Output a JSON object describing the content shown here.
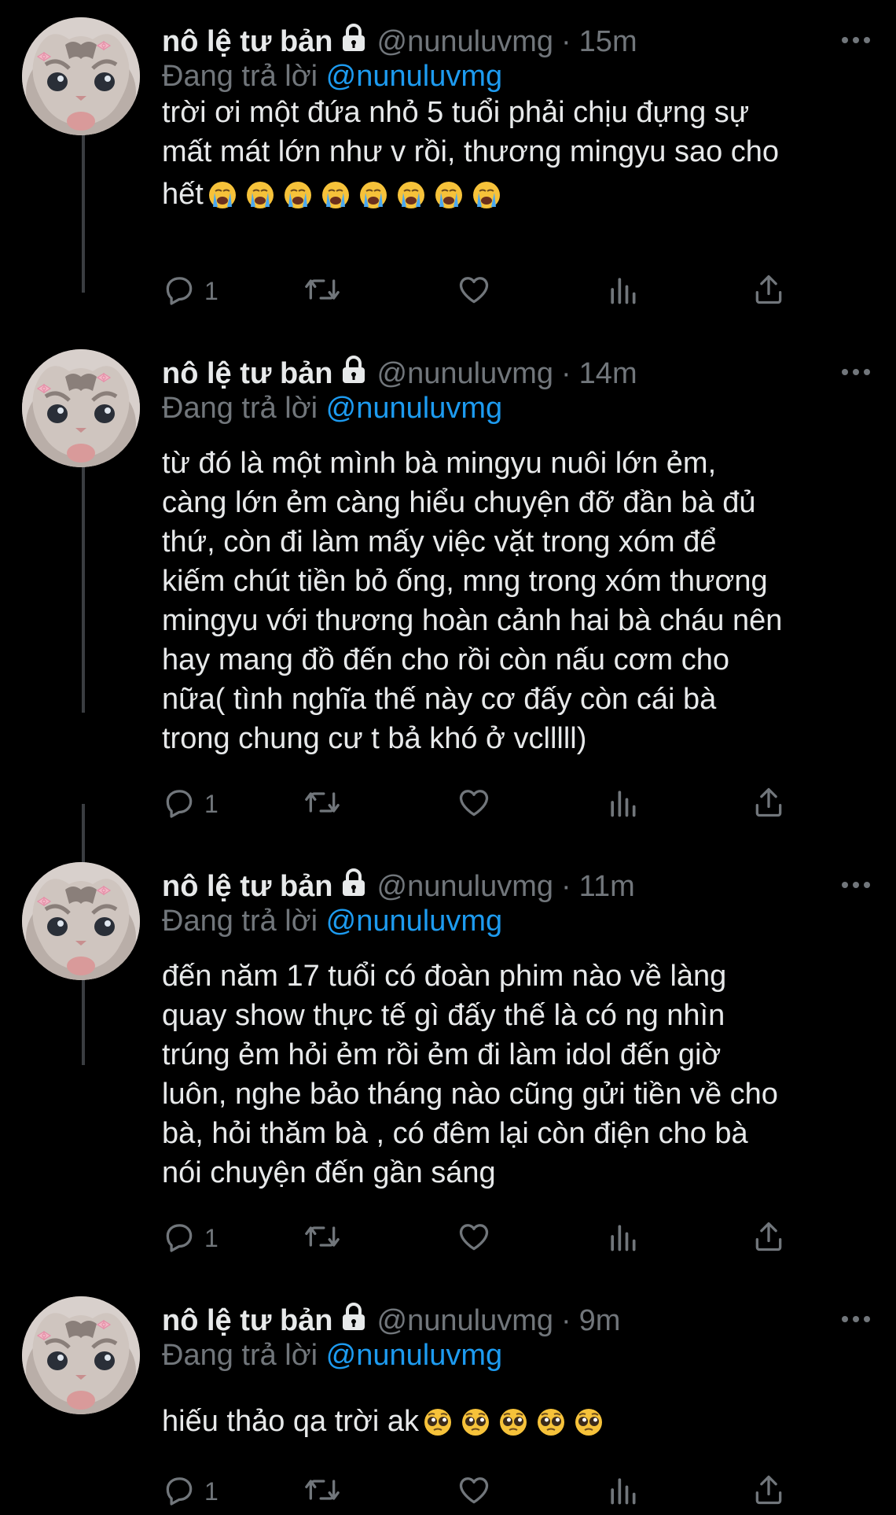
{
  "thread": {
    "tweets": [
      {
        "author_name": "nô lệ tư bản",
        "handle": "@nunuluvmg",
        "separator": "·",
        "time": "15m",
        "replying_prefix": "Đang trả lời",
        "replying_to": "@nunuluvmg",
        "text_lines": [
          "trời ơi một đứa nhỏ 5 tuổi phải chịu đựng sự",
          "mất mát lớn như v rồi, thương mingyu sao cho",
          "hết"
        ],
        "emoji": "loudly-crying-face",
        "emoji_count": 8,
        "reply_count": "1"
      },
      {
        "author_name": "nô lệ tư bản",
        "handle": "@nunuluvmg",
        "separator": "·",
        "time": "14m",
        "replying_prefix": "Đang trả lời",
        "replying_to": "@nunuluvmg",
        "text_lines": [
          "từ đó là một mình bà mingyu nuôi lớn ẻm,",
          "càng lớn ẻm càng hiểu chuyện đỡ đần bà đủ",
          "thứ, còn đi làm mấy việc vặt trong xóm để",
          "kiếm chút tiền bỏ ống, mng trong xóm thương",
          "mingyu với thương hoàn cảnh hai bà cháu nên",
          "hay mang đồ đến cho rồi còn nấu cơm cho",
          "nữa( tình nghĩa thế này cơ đấy còn cái bà",
          "trong chung cư t bả khó ở vclllll)"
        ],
        "reply_count": "1"
      },
      {
        "author_name": "nô lệ tư bản",
        "handle": "@nunuluvmg",
        "separator": "·",
        "time": "11m",
        "replying_prefix": "Đang trả lời",
        "replying_to": "@nunuluvmg",
        "text_lines": [
          "đến năm 17 tuổi có đoàn phim nào về làng",
          "quay show thực tế gì đấy thế là có ng nhìn",
          "trúng ẻm hỏi ẻm rồi ẻm đi làm idol đến giờ",
          "luôn, nghe bảo tháng nào cũng gửi tiền về cho",
          "bà, hỏi thăm bà , có đêm lại còn điện cho bà",
          "nói chuyện đến gần sáng"
        ],
        "reply_count": "1"
      },
      {
        "author_name": "nô lệ tư bản",
        "handle": "@nunuluvmg",
        "separator": "·",
        "time": "9m",
        "replying_prefix": "Đang trả lời",
        "replying_to": "@nunuluvmg",
        "text_lines": [
          "hiếu thảo qa trời ak"
        ],
        "emoji": "pleading-face",
        "emoji_count": 5,
        "reply_count": "1"
      }
    ]
  },
  "icons": {
    "reply": "reply-icon",
    "retweet": "retweet-icon",
    "like": "heart-icon",
    "analytics": "analytics-icon",
    "share": "share-icon",
    "more": "more-options-icon",
    "lock": "lock-icon",
    "avatar": "cat-avatar"
  },
  "colors": {
    "background": "#000000",
    "text": "#e7e9ea",
    "secondary": "#71767b",
    "mention": "#1d9bf0",
    "thread_line": "#3a3d41"
  }
}
